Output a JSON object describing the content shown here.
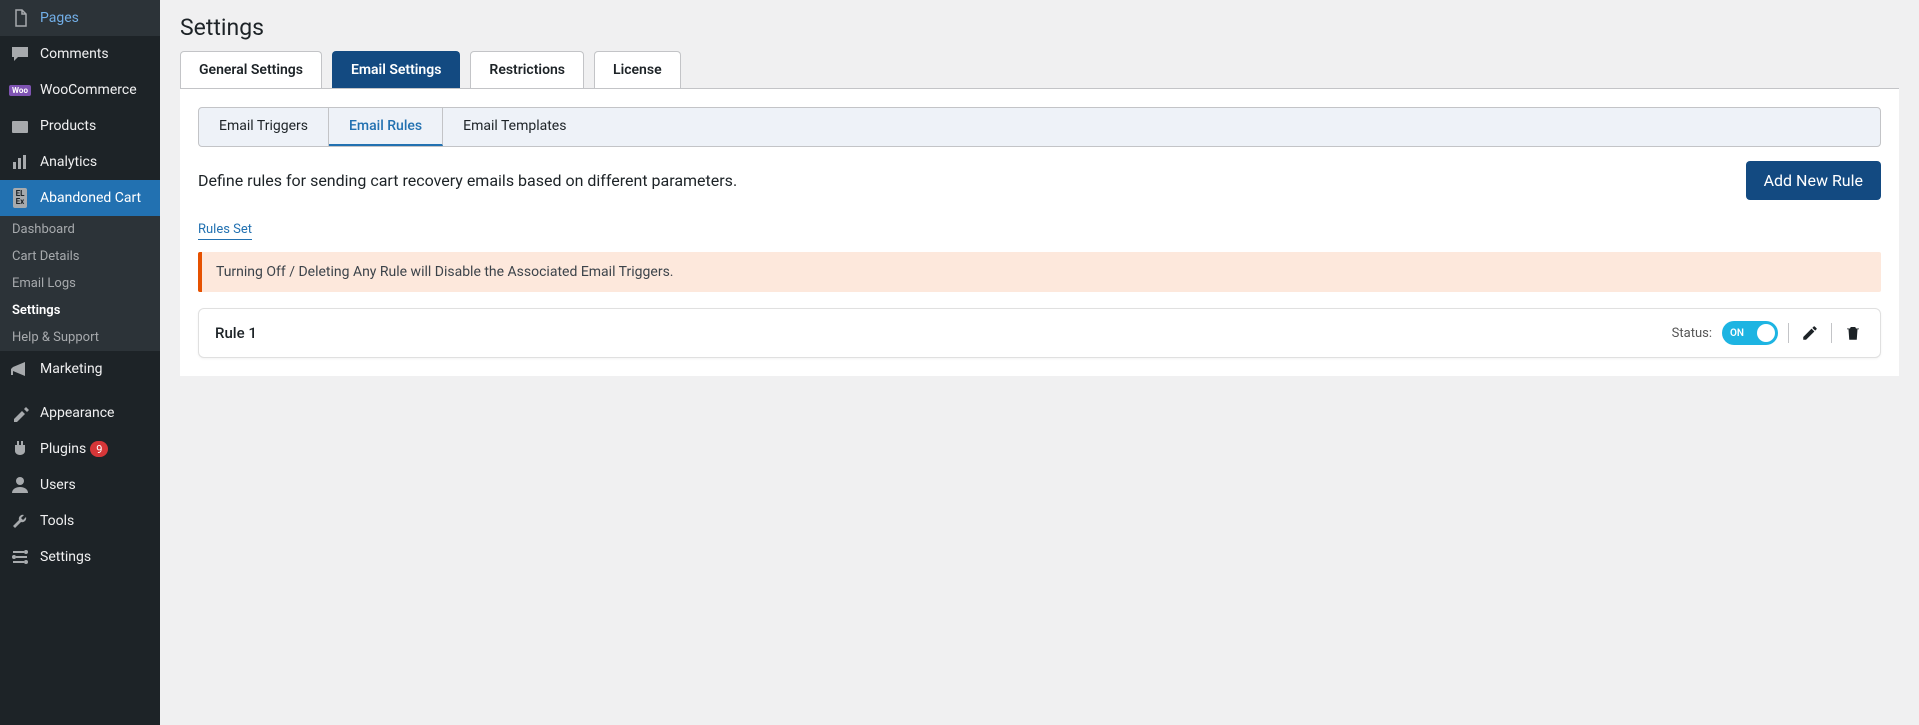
{
  "sidebar": {
    "items": [
      {
        "label": "Pages"
      },
      {
        "label": "Comments"
      },
      {
        "label": "WooCommerce"
      },
      {
        "label": "Products"
      },
      {
        "label": "Analytics"
      },
      {
        "label": "Abandoned Cart"
      },
      {
        "label": "Marketing"
      },
      {
        "label": "Appearance"
      },
      {
        "label": "Plugins",
        "badge": "9"
      },
      {
        "label": "Users"
      },
      {
        "label": "Tools"
      },
      {
        "label": "Settings"
      }
    ],
    "submenu": [
      {
        "label": "Dashboard"
      },
      {
        "label": "Cart Details"
      },
      {
        "label": "Email Logs"
      },
      {
        "label": "Settings"
      },
      {
        "label": "Help & Support"
      }
    ]
  },
  "page": {
    "title": "Settings",
    "tabs": [
      {
        "label": "General Settings"
      },
      {
        "label": "Email Settings"
      },
      {
        "label": "Restrictions"
      },
      {
        "label": "License"
      }
    ],
    "subtabs": [
      {
        "label": "Email Triggers"
      },
      {
        "label": "Email Rules"
      },
      {
        "label": "Email Templates"
      }
    ],
    "description": "Define rules for sending cart recovery emails based on different parameters.",
    "add_button": "Add New Rule",
    "section_label": "Rules Set",
    "alert": "Turning Off / Deleting Any Rule will Disable the Associated Email Triggers.",
    "rules": [
      {
        "name": "Rule 1",
        "status_label": "Status:",
        "toggle_text": "ON"
      }
    ]
  }
}
